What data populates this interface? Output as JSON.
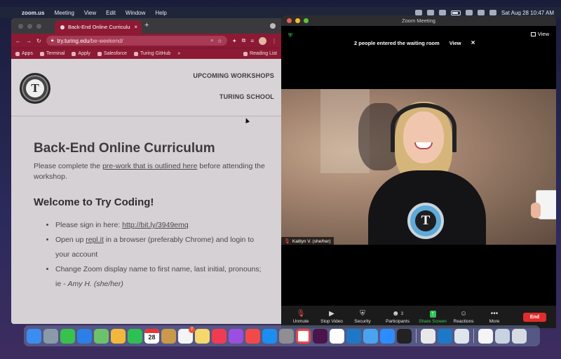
{
  "menubar": {
    "app_name": "zoom.us",
    "items": [
      "Meeting",
      "View",
      "Edit",
      "Window",
      "Help"
    ],
    "clock": "Sat Aug 28  10:47 AM"
  },
  "chrome": {
    "tab_title": "Back-End Online Curriculum -",
    "url_domain": "try.turing.edu",
    "url_path": "/be-weekend/",
    "bookmarks": [
      "Apps",
      "Terminal",
      "Apply",
      "Salesforce",
      "Turing GitHub"
    ],
    "reading_list": "Reading List"
  },
  "page": {
    "logo_letter": "T",
    "nav": [
      "UPCOMING WORKSHOPS",
      "TURING SCHOOL"
    ],
    "heading": "Back-End Online Curriculum",
    "intro_before": "Please complete the ",
    "intro_link": "pre-work that is outlined here",
    "intro_after": " before attending the workshop.",
    "welcome": "Welcome to Try Coding!",
    "step1_text": "Please sign in here: ",
    "step1_link": "http://bit.ly/3949emq",
    "step2_before": "Open up ",
    "step2_link": "repl.it",
    "step2_after": " in a browser (preferably Chrome) and login to your account",
    "step3_text": "Change Zoom display name to first name, last initial, pronouns; ie - ",
    "step3_example": "Amy H. (she/her)"
  },
  "zoom": {
    "window_title": "Zoom Meeting",
    "view_label": "View",
    "waiting_notice": "2 people entered the waiting room",
    "notice_view": "View",
    "notice_close": "×",
    "participant_name": "Kaitlyn V. (she/her)",
    "shirt_letter": "T",
    "controls": {
      "unmute": "Unmute",
      "stop_video": "Stop Video",
      "security": "Security",
      "participants": "Participants",
      "participants_count": "3",
      "share_screen": "Share Screen",
      "reactions": "Reactions",
      "more": "More",
      "end": "End"
    }
  },
  "dock": {
    "calendar_day": "28",
    "reminders_badge": "7",
    "apps": [
      "finder-icon",
      "launchpad-icon",
      "messages-icon",
      "mail-icon",
      "maps-icon",
      "photos-icon",
      "facetime-icon",
      "calendar-icon",
      "notes-app-icon",
      "reminders-icon",
      "stickies-icon",
      "music-icon",
      "podcasts-icon",
      "news-icon",
      "app-store-icon",
      "system-preferences-icon",
      "chrome-icon",
      "slack-icon",
      "notion-icon",
      "vscode-icon",
      "xcode-icon",
      "zoom-icon",
      "terminal-icon",
      "textedit-icon",
      "vscode-icon",
      "preview-icon",
      "document-icon",
      "downloads-icon",
      "trash-icon"
    ]
  }
}
